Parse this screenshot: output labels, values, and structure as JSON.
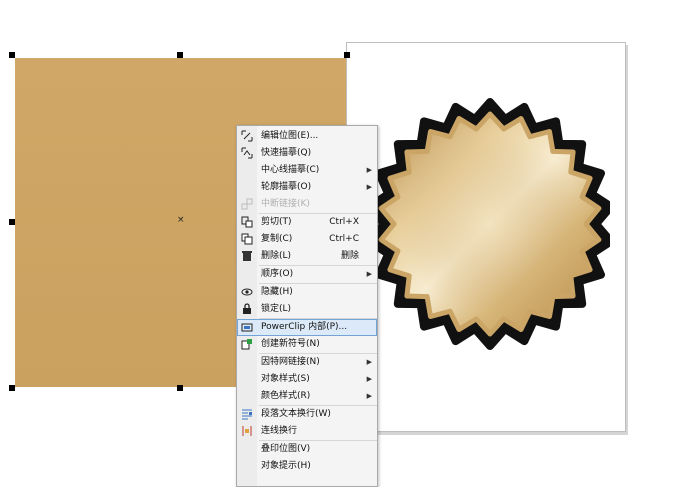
{
  "context_menu": {
    "items": [
      {
        "label": "编辑位图(E)...",
        "icon": "edit-bitmap-icon"
      },
      {
        "label": "快速描摹(Q)",
        "icon": "quick-trace-icon"
      },
      {
        "label": "中心线描摹(C)",
        "submenu": true
      },
      {
        "label": "轮廓描摹(O)",
        "submenu": true
      },
      {
        "label": "中断链接(K)",
        "disabled": true,
        "icon": "break-link-icon"
      },
      {
        "label": "剪切(T)",
        "shortcut": "Ctrl+X",
        "icon": "cut-icon"
      },
      {
        "label": "复制(C)",
        "shortcut": "Ctrl+C",
        "icon": "copy-icon"
      },
      {
        "label": "删除(L)",
        "shortcut": "删除",
        "icon": "delete-icon"
      },
      {
        "label": "顺序(O)",
        "submenu": true
      },
      {
        "label": "隐藏(H)",
        "icon": "eye-icon"
      },
      {
        "label": "锁定(L)",
        "icon": "lock-icon"
      },
      {
        "label": "PowerClip 内部(P)...",
        "highlighted": true,
        "icon": "powerclip-icon"
      },
      {
        "label": "创建新符号(N)",
        "icon": "new-symbol-icon"
      },
      {
        "label": "因特网链接(N)",
        "submenu": true
      },
      {
        "label": "对象样式(S)",
        "submenu": true
      },
      {
        "label": "颜色样式(R)",
        "submenu": true
      },
      {
        "label": "段落文本换行(W)",
        "icon": "paragraph-wrap-icon"
      },
      {
        "label": "连线换行",
        "icon": "line-wrap-icon"
      },
      {
        "label": "叠印位图(V)"
      },
      {
        "label": "对象提示(H)"
      }
    ]
  },
  "colors": {
    "bitmap_fill": "#cda463",
    "seal_outline": "#111111",
    "seal_gold_light": "#f6e6c2",
    "seal_gold_dark": "#b9904e",
    "highlight": "#dbe9f8"
  }
}
